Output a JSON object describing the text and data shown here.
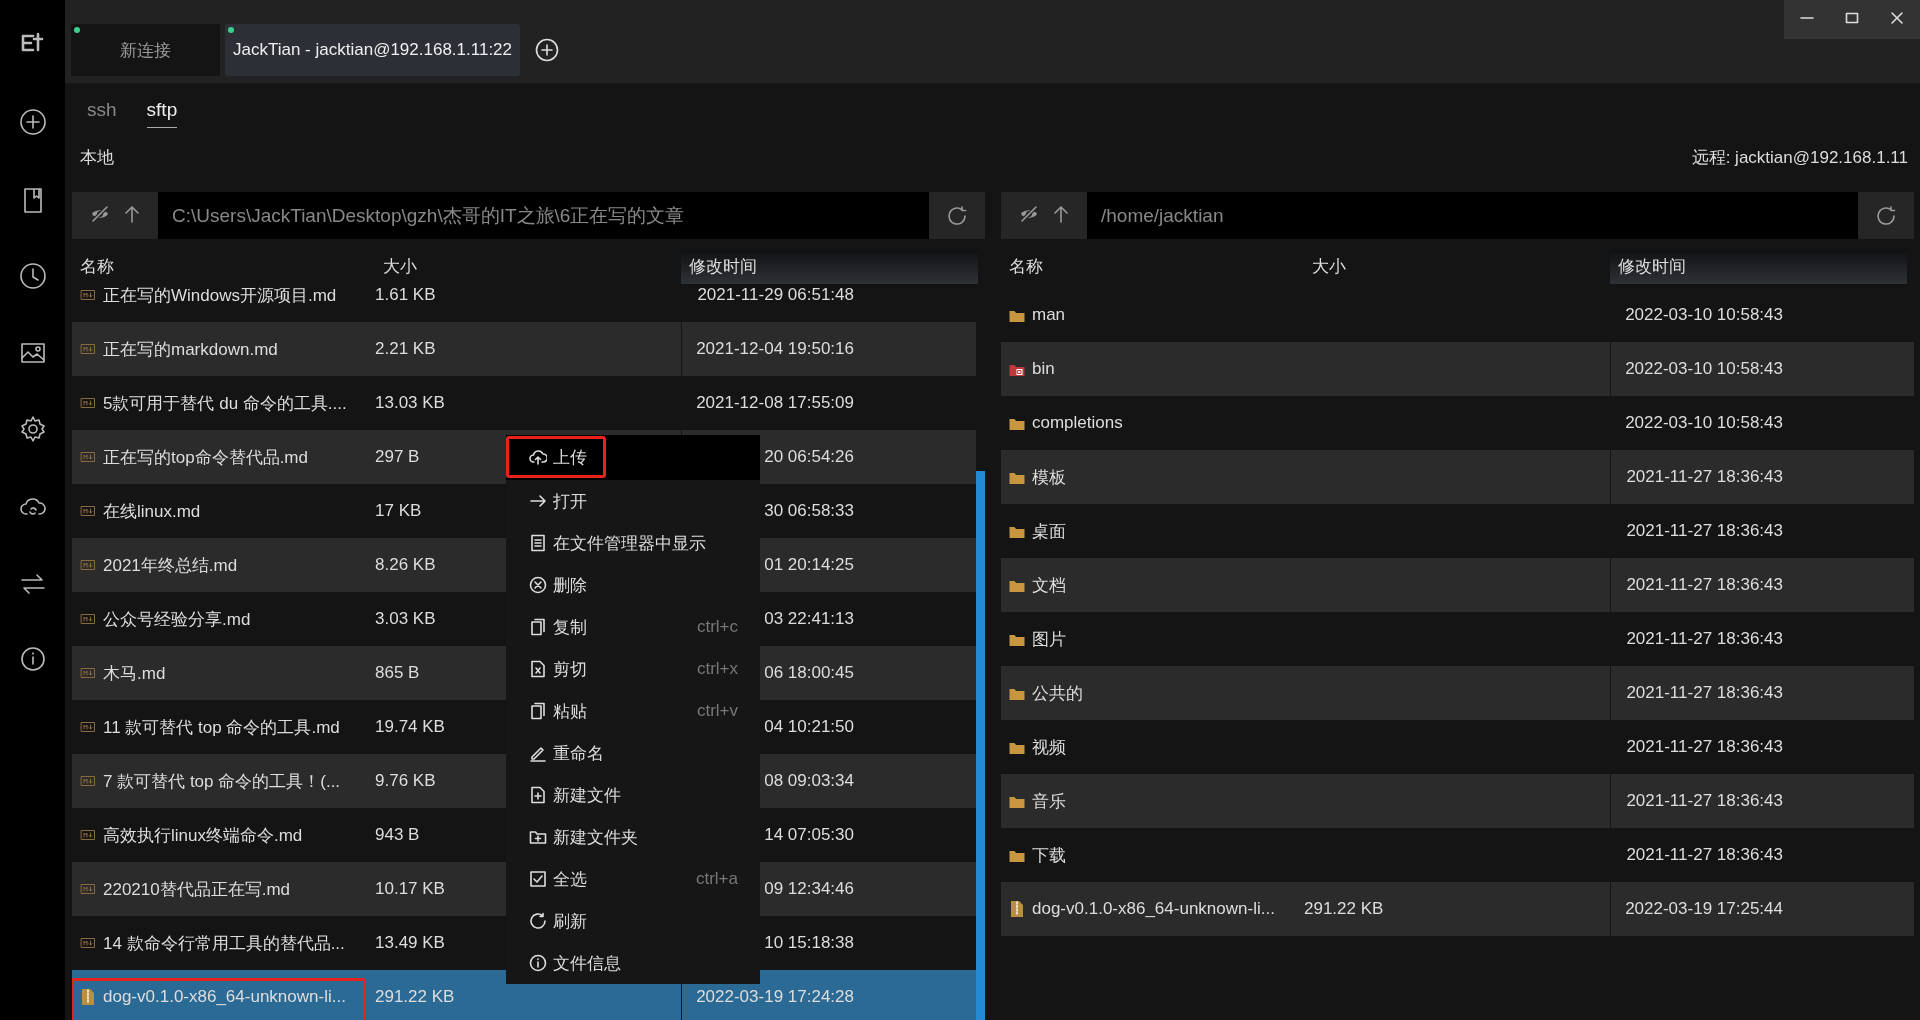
{
  "tabs": [
    {
      "label": "新连接",
      "selected": false
    },
    {
      "label": "JackTian - jacktian@192.168.1.11:22",
      "selected": true
    }
  ],
  "mode_tabs": [
    {
      "label": "ssh",
      "selected": false
    },
    {
      "label": "sftp",
      "selected": true
    }
  ],
  "panels": [
    {
      "label": "本地",
      "path": "C:\\Users\\JackTian\\Desktop\\gzh\\杰哥的IT之旅\\6正在写的文章",
      "columns": [
        "名称",
        "大小",
        "修改时间"
      ],
      "rows": [
        {
          "kind": "markdown",
          "name": "正在写的Windows开源项目.md",
          "size": "1.61 KB",
          "modified": "2021-11-29 06:51:48",
          "selected": false,
          "annotated": false
        },
        {
          "kind": "markdown",
          "name": "正在写的markdown.md",
          "size": "2.21 KB",
          "modified": "2021-12-04 19:50:16",
          "selected": false,
          "annotated": false
        },
        {
          "kind": "markdown",
          "name": "5款可用于替代 du 命令的工具....",
          "size": "13.03 KB",
          "modified": "2021-12-08 17:55:09",
          "selected": false,
          "annotated": false
        },
        {
          "kind": "markdown",
          "name": "正在写的top命令替代品.md",
          "size": "297 B",
          "modified": "20 06:54:26",
          "selected": false,
          "annotated": false
        },
        {
          "kind": "markdown",
          "name": "在线linux.md",
          "size": "17 KB",
          "modified": "30 06:58:33",
          "selected": false,
          "annotated": false
        },
        {
          "kind": "markdown",
          "name": "2021年终总结.md",
          "size": "8.26 KB",
          "modified": "01 20:14:25",
          "selected": false,
          "annotated": false
        },
        {
          "kind": "markdown",
          "name": "公众号经验分享.md",
          "size": "3.03 KB",
          "modified": "03 22:41:13",
          "selected": false,
          "annotated": false
        },
        {
          "kind": "markdown",
          "name": "木马.md",
          "size": "865 B",
          "modified": "06 18:00:45",
          "selected": false,
          "annotated": false
        },
        {
          "kind": "markdown",
          "name": "11 款可替代 top 命令的工具.md",
          "size": "19.74 KB",
          "modified": "04 10:21:50",
          "selected": false,
          "annotated": false
        },
        {
          "kind": "markdown",
          "name": "7 款可替代 top 命令的工具！(...",
          "size": "9.76 KB",
          "modified": "08 09:03:34",
          "selected": false,
          "annotated": false
        },
        {
          "kind": "markdown",
          "name": "高效执行linux终端命令.md",
          "size": "943 B",
          "modified": "14 07:05:30",
          "selected": false,
          "annotated": false
        },
        {
          "kind": "markdown",
          "name": "220210替代品正在写.md",
          "size": "10.17 KB",
          "modified": "09 12:34:46",
          "selected": false,
          "annotated": false
        },
        {
          "kind": "markdown",
          "name": "14 款命令行常用工具的替代品...",
          "size": "13.49 KB",
          "modified": "10 15:18:38",
          "selected": false,
          "annotated": false
        },
        {
          "kind": "archive",
          "name": "dog-v0.1.0-x86_64-unknown-li...",
          "size": "291.22 KB",
          "modified": "2022-03-19 17:24:28",
          "selected": true,
          "annotated": true
        }
      ]
    },
    {
      "label": "远程: jacktian@192.168.1.11",
      "path": "/home/jacktian",
      "columns": [
        "名称",
        "大小",
        "修改时间"
      ],
      "rows": [
        {
          "kind": "folder",
          "name": "man",
          "modified": "2022-03-10 10:58:43",
          "selected": false,
          "annotated": false
        },
        {
          "kind": "special-folder",
          "name": "bin",
          "modified": "2022-03-10 10:58:43",
          "selected": false,
          "annotated": false
        },
        {
          "kind": "folder",
          "name": "completions",
          "modified": "2022-03-10 10:58:43",
          "selected": false,
          "annotated": false
        },
        {
          "kind": "folder",
          "name": "模板",
          "modified": "2021-11-27 18:36:43",
          "selected": false,
          "annotated": false
        },
        {
          "kind": "folder",
          "name": "桌面",
          "modified": "2021-11-27 18:36:43",
          "selected": false,
          "annotated": false
        },
        {
          "kind": "folder",
          "name": "文档",
          "modified": "2021-11-27 18:36:43",
          "selected": false,
          "annotated": false
        },
        {
          "kind": "folder",
          "name": "图片",
          "modified": "2021-11-27 18:36:43",
          "selected": false,
          "annotated": false
        },
        {
          "kind": "folder",
          "name": "公共的",
          "modified": "2021-11-27 18:36:43",
          "selected": false,
          "annotated": false
        },
        {
          "kind": "folder",
          "name": "视频",
          "modified": "2021-11-27 18:36:43",
          "selected": false,
          "annotated": false
        },
        {
          "kind": "folder",
          "name": "音乐",
          "modified": "2021-11-27 18:36:43",
          "selected": false,
          "annotated": false
        },
        {
          "kind": "folder",
          "name": "下载",
          "modified": "2021-11-27 18:36:43",
          "selected": false,
          "annotated": false
        },
        {
          "kind": "archive",
          "name": "dog-v0.1.0-x86_64-unknown-li...",
          "size": "291.22 KB",
          "modified": "2022-03-19 17:25:44",
          "selected": false,
          "annotated": false
        }
      ]
    }
  ],
  "context_menu": {
    "items": [
      {
        "label": "上传",
        "highlighted": true,
        "annotated": true
      },
      {
        "label": "打开",
        "highlighted": false,
        "annotated": false
      },
      {
        "label": "在文件管理器中显示",
        "highlighted": false,
        "annotated": false
      },
      {
        "label": "删除",
        "highlighted": false,
        "annotated": false
      },
      {
        "label": "复制",
        "shortcut": "ctrl+c",
        "highlighted": false,
        "annotated": false
      },
      {
        "label": "剪切",
        "shortcut": "ctrl+x",
        "highlighted": false,
        "annotated": false
      },
      {
        "label": "粘贴",
        "shortcut": "ctrl+v",
        "highlighted": false,
        "annotated": false
      },
      {
        "label": "重命名",
        "highlighted": false,
        "annotated": false
      },
      {
        "label": "新建文件",
        "highlighted": false,
        "annotated": false
      },
      {
        "label": "新建文件夹",
        "highlighted": false,
        "annotated": false
      },
      {
        "label": "全选",
        "shortcut": "ctrl+a",
        "highlighted": false,
        "annotated": false
      },
      {
        "label": "刷新",
        "highlighted": false,
        "annotated": false
      },
      {
        "label": "文件信息",
        "highlighted": false,
        "annotated": false
      }
    ]
  }
}
